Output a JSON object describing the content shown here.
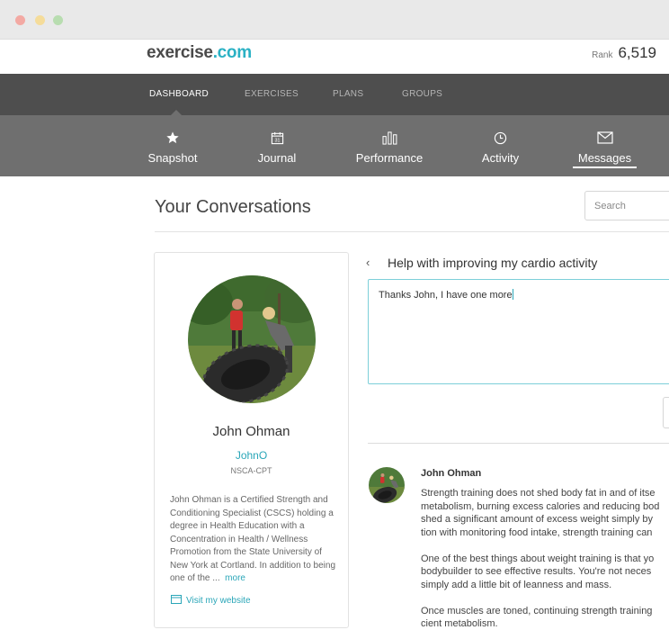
{
  "site": {
    "logo_main": "exercise",
    "logo_suffix": ".com",
    "rank_label": "Rank",
    "rank_value": "6,519"
  },
  "main_nav": [
    "DASHBOARD",
    "EXERCISES",
    "PLANS",
    "GROUPS"
  ],
  "main_nav_active": "DASHBOARD",
  "sub_nav": [
    {
      "label": "Snapshot",
      "icon": "star-icon"
    },
    {
      "label": "Journal",
      "icon": "calendar-icon"
    },
    {
      "label": "Performance",
      "icon": "bar-chart-icon"
    },
    {
      "label": "Activity",
      "icon": "clock-icon"
    },
    {
      "label": "Messages",
      "icon": "envelope-icon"
    }
  ],
  "sub_nav_active": "Messages",
  "page": {
    "title": "Your Conversations",
    "search_placeholder": "Search"
  },
  "profile": {
    "name": "John Ohman",
    "handle": "JohnO",
    "cert": "NSCA-CPT",
    "bio": "John Ohman is a Certified Strength and Conditioning Specialist (CSCS) holding a degree in Health Education with a Concentration in Health / Wellness Promotion from the State University of New York at Cortland.  In addition to being one of the ...",
    "more_label": "more",
    "website_label": "Visit my website"
  },
  "conversation": {
    "subject": "Help with improving my cardio activity",
    "reply_text": "Thanks John, I have one more",
    "message": {
      "author": "John Ohman",
      "paragraphs": [
        [
          "Strength training does not shed body fat in and of itse",
          "metabolism, burning excess calories and reducing bod",
          "shed a significant amount of excess weight simply by",
          "tion with monitoring food intake, strength training can"
        ],
        [
          "One of the best things about weight training is that yo",
          "bodybuilder to see effective results.  You're not neces",
          "simply add a little bit of leanness and mass."
        ],
        [
          "Once muscles are toned, continuing strength training",
          "cient metabolism."
        ]
      ]
    }
  },
  "colors": {
    "accent": "#2ab1c4",
    "nav_dark": "#4e4e4e",
    "nav_sub": "#6f6f6f"
  }
}
